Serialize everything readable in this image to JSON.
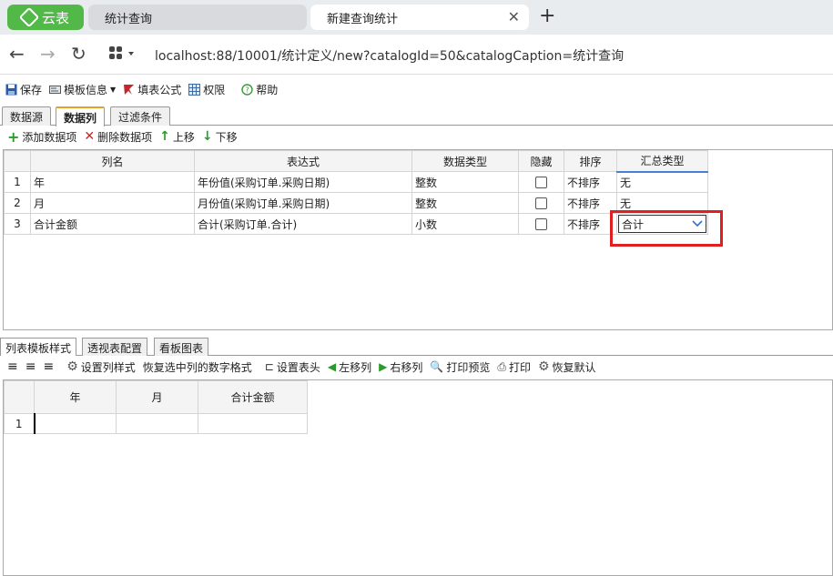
{
  "browser": {
    "brand": "云表",
    "tabs": [
      {
        "label": "统计查询"
      },
      {
        "label": "新建查询统计"
      }
    ],
    "new_tab_symbol": "+",
    "url": "localhost:88/10001/统计定义/new?catalogId=50&catalogCaption=统计查询"
  },
  "toolbar": {
    "save": "保存",
    "template_info": "模板信息",
    "fill_formula": "填表公式",
    "permission": "权限",
    "help": "帮助"
  },
  "tabs": [
    "数据源",
    "数据列",
    "过滤条件"
  ],
  "column_toolbar": {
    "add": "添加数据项",
    "delete": "删除数据项",
    "up": "上移",
    "down": "下移"
  },
  "column_grid": {
    "headers": [
      "列名",
      "表达式",
      "数据类型",
      "隐藏",
      "排序",
      "汇总类型"
    ],
    "rows": [
      {
        "num": "1",
        "name": "年",
        "expr": "年份值(采购订单.采购日期)",
        "type": "整数",
        "sort": "不排序",
        "summary": "无"
      },
      {
        "num": "2",
        "name": "月",
        "expr": "月份值(采购订单.采购日期)",
        "type": "整数",
        "sort": "不排序",
        "summary": "无"
      },
      {
        "num": "3",
        "name": "合计金额",
        "expr": "合计(采购订单.合计)",
        "type": "小数",
        "sort": "不排序",
        "summary": "合计"
      }
    ]
  },
  "bottom_tabs": [
    "列表模板样式",
    "透视表配置",
    "看板图表"
  ],
  "style_toolbar": {
    "set_style": "设置列样式",
    "restore_format": "恢复选中列的数字格式",
    "set_header": "设置表头",
    "move_left": "左移列",
    "move_right": "右移列",
    "print_preview": "打印预览",
    "print": "打印",
    "restore_default": "恢复默认"
  },
  "preview_grid": {
    "headers": [
      "年",
      "月",
      "合计金额"
    ],
    "row_num": "1"
  }
}
